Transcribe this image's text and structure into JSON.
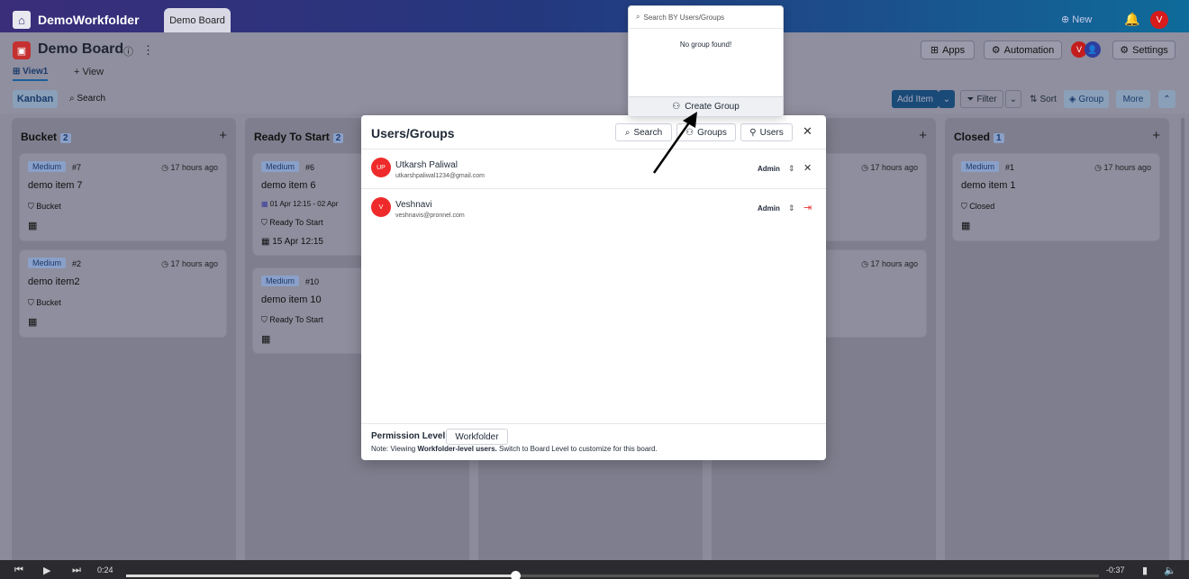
{
  "app": {
    "workfolder": "DemoWorkfolder",
    "board_tab": "Demo Board",
    "new_label": "New",
    "avatar_initial": "V"
  },
  "board": {
    "title": "Demo Board",
    "view_tab": "View1",
    "add_view": "+ View",
    "header_buttons": {
      "apps": "Apps",
      "automation": "Automation",
      "settings": "Settings"
    },
    "toolbar": {
      "kanban": "Kanban",
      "search": "Search",
      "add_item": "Add Item",
      "filter": "Filter",
      "sort": "Sort",
      "group": "Group",
      "more": "More"
    }
  },
  "columns": [
    {
      "name": "Bucket",
      "count": "2",
      "cards": [
        {
          "tag": "Medium",
          "num": "#7",
          "time": "17 hours ago",
          "title": "demo item 7",
          "status": "Bucket"
        },
        {
          "tag": "Medium",
          "num": "#2",
          "time": "17 hours ago",
          "title": "demo item2",
          "status": "Bucket"
        }
      ]
    },
    {
      "name": "Ready To Start",
      "count": "2",
      "cards": [
        {
          "tag": "Medium",
          "num": "#6",
          "time": "",
          "title": "demo item 6",
          "range": "01 Apr 12:15  -  02 Apr",
          "status": "Ready To Start",
          "due": "15 Apr 12:15"
        },
        {
          "tag": "Medium",
          "num": "#10",
          "time": "",
          "title": "demo item 10",
          "status": "Ready To Start"
        }
      ]
    },
    {
      "name": "",
      "count": "",
      "cards": [
        {
          "time": "17 hours ago"
        },
        {
          "time": "17 hours ago"
        }
      ]
    },
    {
      "name": "Closed",
      "count": "1",
      "cards": [
        {
          "tag": "Medium",
          "num": "#1",
          "time": "17 hours ago",
          "title": "demo item 1",
          "status": "Closed"
        }
      ]
    }
  ],
  "modal": {
    "title": "Users/Groups",
    "buttons": {
      "search": "Search",
      "groups": "Groups",
      "users": "Users"
    },
    "users": [
      {
        "initials": "UP",
        "name": "Utkarsh Paliwal",
        "email": "utkarshpaliwal1234@gmail.com",
        "role": "Admin"
      },
      {
        "initials": "V",
        "name": "Veshnavi",
        "email": "veshnavis@pronnel.com",
        "role": "Admin"
      }
    ],
    "permission_label": "Permission Level",
    "permission_value": "Workfolder",
    "note_prefix": "Note: Viewing ",
    "note_bold": "Workfolder-level users.",
    "note_suffix": " Switch to Board Level to customize for this board."
  },
  "dropdown": {
    "search_placeholder": "Search BY Users/Groups",
    "empty": "No group found!",
    "create": "Create Group"
  },
  "player": {
    "elapsed": "0:24",
    "remaining": "-0:37",
    "progress_fraction": 0.4
  },
  "colors": {
    "accent": "#1d4c8a",
    "danger": "#ef2a2a"
  }
}
